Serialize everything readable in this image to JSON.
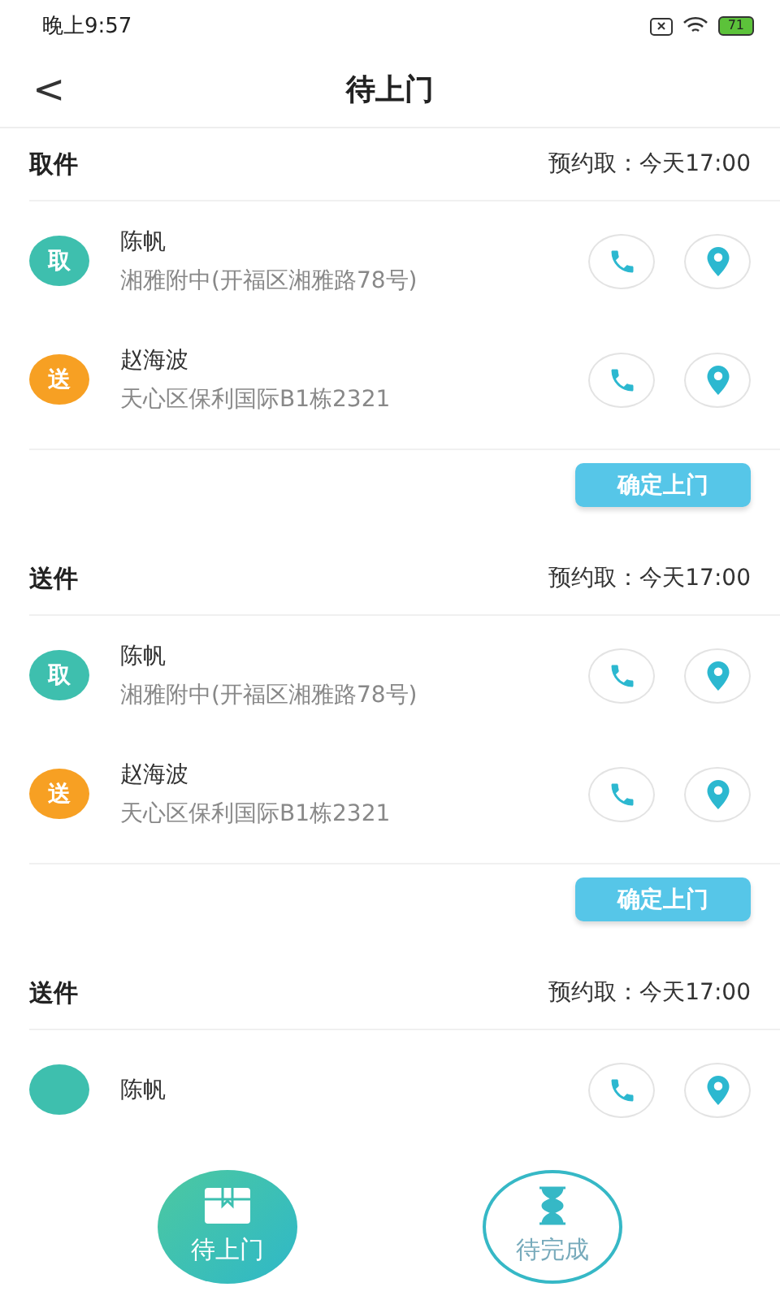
{
  "status_bar": {
    "time": "晚上9:57",
    "battery": "71"
  },
  "header": {
    "back": "<",
    "title": "待上门"
  },
  "sections": [
    {
      "title": "取件",
      "appointment": "预约取：今天17:00",
      "stops": [
        {
          "kind": "pickup",
          "badge": "取",
          "name": "陈帆",
          "address": "湘雅附中(开福区湘雅路78号)"
        },
        {
          "kind": "delivery",
          "badge": "送",
          "name": "赵海波",
          "address": "天心区保利国际B1栋2321"
        }
      ],
      "button": "确定上门"
    },
    {
      "title": "送件",
      "appointment": "预约取：今天17:00",
      "stops": [
        {
          "kind": "pickup",
          "badge": "取",
          "name": "陈帆",
          "address": "湘雅附中(开福区湘雅路78号)"
        },
        {
          "kind": "delivery",
          "badge": "送",
          "name": "赵海波",
          "address": "天心区保利国际B1栋2321"
        }
      ],
      "button": "确定上门"
    },
    {
      "title": "送件",
      "appointment": "预约取：今天17:00",
      "stops": [
        {
          "kind": "pickup",
          "name": "陈帆"
        }
      ]
    }
  ],
  "tabs": [
    {
      "label": "待上门",
      "selected": true
    },
    {
      "label": "待完成",
      "selected": false
    }
  ]
}
